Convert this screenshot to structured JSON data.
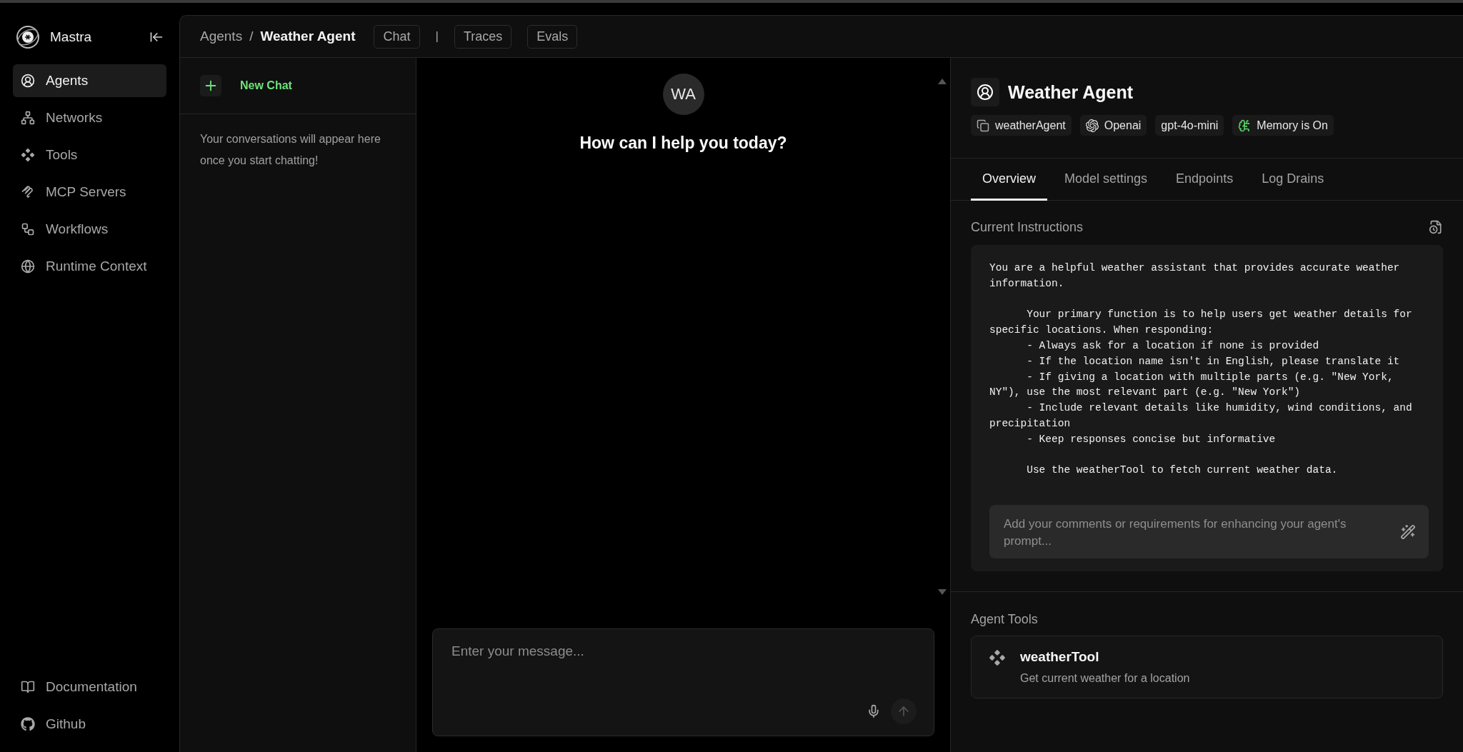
{
  "sidebar": {
    "brand": "Mastra",
    "items": [
      {
        "kind": "agents",
        "label": "Agents",
        "selected": true
      },
      {
        "kind": "networks",
        "label": "Networks",
        "selected": false
      },
      {
        "kind": "tools",
        "label": "Tools",
        "selected": false
      },
      {
        "kind": "mcp",
        "label": "MCP Servers",
        "selected": false
      },
      {
        "kind": "workflows",
        "label": "Workflows",
        "selected": false
      },
      {
        "kind": "runtime",
        "label": "Runtime Context",
        "selected": false
      }
    ],
    "footer_links": [
      {
        "kind": "docs",
        "label": "Documentation"
      },
      {
        "kind": "github",
        "label": "Github"
      }
    ]
  },
  "header": {
    "breadcrumb": [
      "Agents",
      "Weather Agent"
    ],
    "breadcrumb_separator": "/",
    "tabs": [
      "Chat",
      "Traces",
      "Evals"
    ],
    "separator": "|"
  },
  "conversations": {
    "new_chat": "New Chat",
    "empty_text": "Your conversations will appear here once you start chatting!"
  },
  "chat": {
    "avatar": "WA",
    "greeting": "How can I help you today?",
    "input": {
      "placeholder": "Enter your message..."
    }
  },
  "agent": {
    "name": "Weather Agent",
    "badges": [
      {
        "kind": "id",
        "label": "weatherAgent"
      },
      {
        "kind": "provider",
        "label": "Openai"
      },
      {
        "kind": "model",
        "label": "gpt-4o-mini"
      },
      {
        "kind": "memory",
        "label": "Memory is On"
      }
    ],
    "tabs": [
      {
        "label": "Overview",
        "selected": true
      },
      {
        "label": "Model settings",
        "selected": false
      },
      {
        "label": "Endpoints",
        "selected": false
      },
      {
        "label": "Log Drains",
        "selected": false
      }
    ],
    "instructions_title": "Current Instructions",
    "instructions": "You are a helpful weather assistant that provides accurate weather information.\n\n      Your primary function is to help users get weather details for specific locations. When responding:\n      - Always ask for a location if none is provided\n      - If the location name isn't in English, please translate it\n      - If giving a location with multiple parts (e.g. \"New York, NY\"), use the most relevant part (e.g. \"New York\")\n      - Include relevant details like humidity, wind conditions, and precipitation\n      - Keep responses concise but informative\n\n      Use the weatherTool to fetch current weather data.",
    "enhance": {
      "placeholder": "Add your comments or requirements for enhancing your agent's prompt..."
    },
    "tools_title": "Agent Tools",
    "tools": [
      {
        "name": "weatherTool",
        "description": "Get current weather for a location"
      }
    ]
  }
}
